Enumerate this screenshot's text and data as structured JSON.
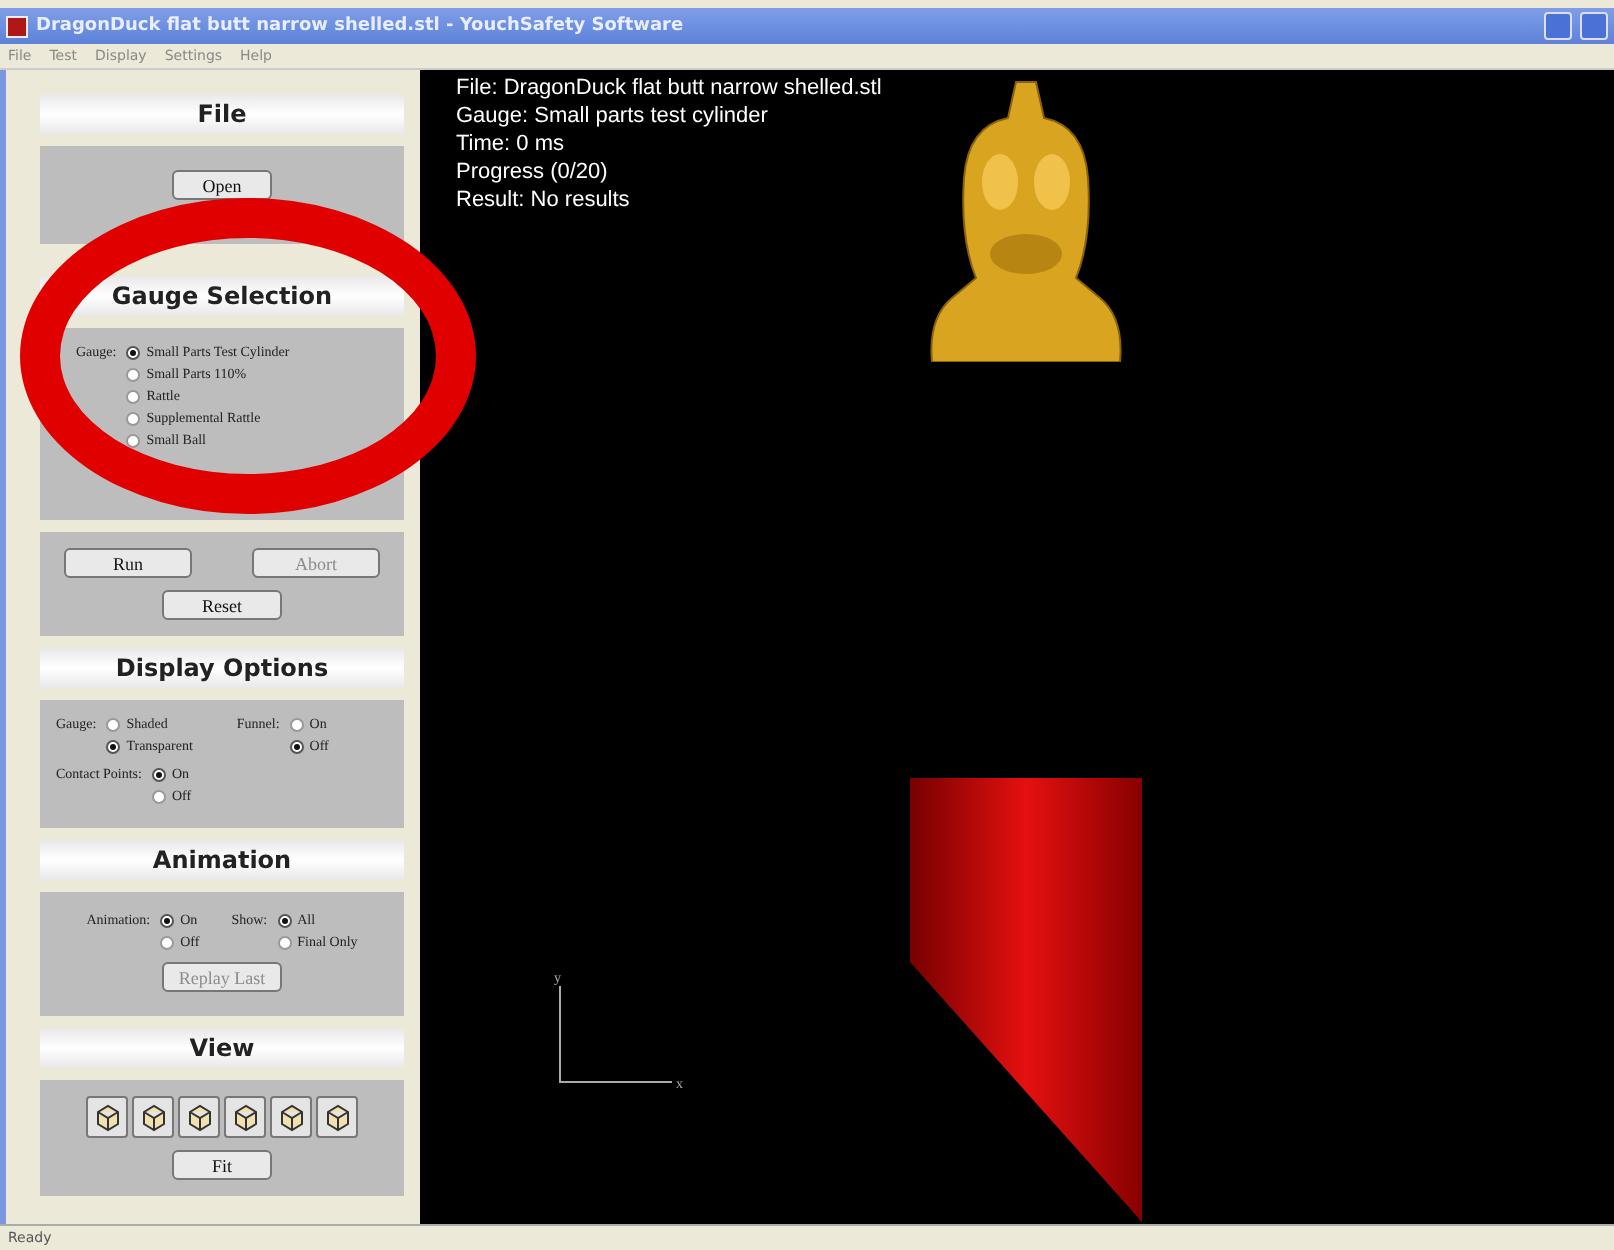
{
  "window": {
    "title": "DragonDuck flat butt narrow shelled.stl - YouchSafety Software"
  },
  "menu": [
    "File",
    "Test",
    "Display",
    "Settings",
    "Help"
  ],
  "file_panel": {
    "title": "File",
    "buttons": [
      {
        "label": "Open",
        "disabled": false
      }
    ]
  },
  "gauge_panel": {
    "title": "Gauge Selection",
    "label": "Gauge:",
    "options": [
      {
        "label": "Small Parts Test Cylinder",
        "selected": true
      },
      {
        "label": "Small Parts 110%",
        "selected": false
      },
      {
        "label": "Rattle",
        "selected": false
      },
      {
        "label": "Supplemental Rattle",
        "selected": false
      },
      {
        "label": "Small Ball",
        "selected": false
      }
    ]
  },
  "run_panel": {
    "buttons": [
      {
        "label": "Run",
        "disabled": false
      },
      {
        "label": "Abort",
        "disabled": true
      },
      {
        "label": "Reset",
        "disabled": false
      }
    ]
  },
  "display_panel": {
    "title": "Display Options",
    "groups": [
      {
        "label": "Gauge:",
        "options": [
          {
            "label": "Shaded",
            "selected": false
          },
          {
            "label": "Transparent",
            "selected": true
          }
        ]
      },
      {
        "label": "Funnel:",
        "options": [
          {
            "label": "On",
            "selected": false
          },
          {
            "label": "Off",
            "selected": true
          }
        ]
      },
      {
        "label": "Contact Points:",
        "options": [
          {
            "label": "On",
            "selected": true
          },
          {
            "label": "Off",
            "selected": false
          }
        ]
      }
    ]
  },
  "animation_panel": {
    "title": "Animation",
    "groups": [
      {
        "label": "Animation:",
        "options": [
          {
            "label": "On",
            "selected": true
          },
          {
            "label": "Off",
            "selected": false
          }
        ]
      },
      {
        "label": "Show:",
        "options": [
          {
            "label": "All",
            "selected": true
          },
          {
            "label": "Final Only",
            "selected": false
          }
        ]
      }
    ],
    "button": {
      "label": "Replay Last",
      "disabled": true
    }
  },
  "view_panel": {
    "title": "View",
    "button": {
      "label": "Fit",
      "disabled": false
    }
  },
  "viewport": {
    "info": [
      "File: DragonDuck flat butt narrow shelled.stl",
      "Gauge: Small parts test cylinder",
      "Time: 0 ms",
      "Progress (0/20)",
      "Result: No results"
    ],
    "axes": {
      "y": "y",
      "x": "x"
    }
  },
  "status_bar": {
    "text": "Ready"
  }
}
